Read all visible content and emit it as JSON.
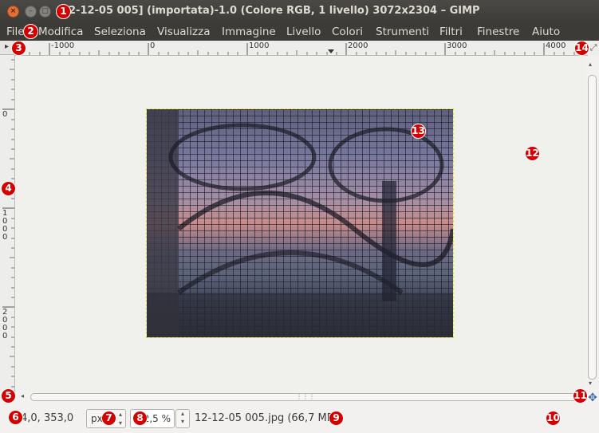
{
  "window": {
    "title": "2-12-05 005] (importata)-1.0 (Colore RGB, 1 livello) 3072x2304 – GIMP",
    "close_glyph": "×",
    "minimize_glyph": "–",
    "maximize_glyph": "□"
  },
  "menubar": {
    "items": [
      "File",
      "Modifica",
      "Seleziona",
      "Visualizza",
      "Immagine",
      "Livello",
      "Colori",
      "Strumenti",
      "Filtri",
      "Finestre",
      "Aiuto"
    ]
  },
  "rulers": {
    "horizontal_labels": [
      "-1000",
      "0",
      "1000",
      "2000",
      "3000",
      "4000"
    ],
    "vertical_labels": [
      "0",
      "1\n0\n0\n0",
      "2\n0\n0\n0"
    ]
  },
  "canvas": {
    "image_name": "12-12-05 005.jpg",
    "image_size": "3072x2304",
    "background_color": "#f0f0ec",
    "selection_color": "#e5e236"
  },
  "statusbar": {
    "coordinates": "4,0, 353,0",
    "unit": "px",
    "zoom": "12,5 %",
    "message": "12-12-05 005.jpg (66,7 MB)"
  },
  "markers": [
    "1",
    "2",
    "3",
    "4",
    "5",
    "6",
    "7",
    "8",
    "9",
    "10",
    "11",
    "12",
    "13",
    "14"
  ],
  "icons": {
    "ruler_corner": "quick-mask-icon",
    "zoom_nav": "zoom-image-icon",
    "navigate": "navigate-icon"
  },
  "colors": {
    "titlebar": "#3c3b37",
    "close_button": "#e56f38",
    "marker": "#d40000"
  }
}
